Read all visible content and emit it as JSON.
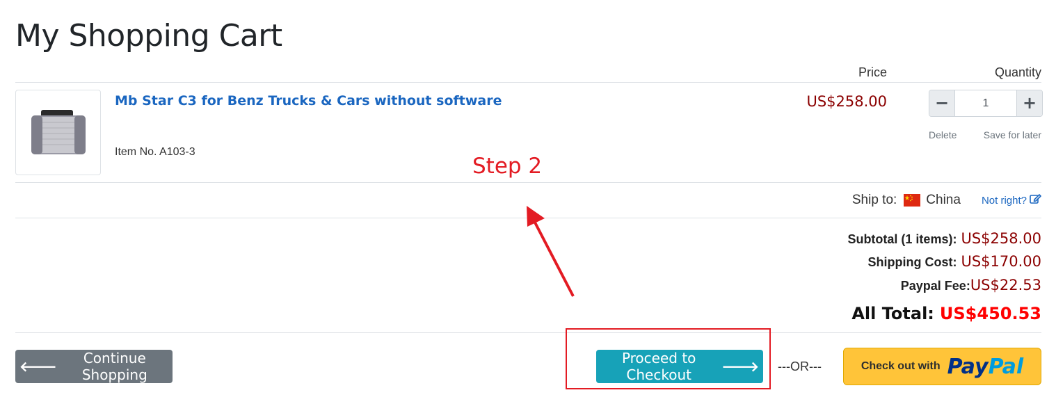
{
  "page": {
    "title": "My Shopping Cart"
  },
  "table_headers": {
    "price": "Price",
    "quantity": "Quantity"
  },
  "item": {
    "name": "Mb Star C3 for Benz Trucks & Cars without software",
    "item_no": "Item No. A103-3",
    "price": "US$258.00",
    "quantity": "1",
    "delete_label": "Delete",
    "save_label": "Save for later"
  },
  "annotation": {
    "step": "Step 2"
  },
  "shipping": {
    "label": "Ship to:",
    "country": "China",
    "not_right": "Not right?"
  },
  "summary": {
    "subtotal_label": "Subtotal (1 items):",
    "subtotal": "US$258.00",
    "shipping_label": "Shipping Cost:",
    "shipping": "US$170.00",
    "paypal_fee_label": "Paypal Fee:",
    "paypal_fee": "US$22.53",
    "total_label": "All Total:",
    "total": "US$450.53"
  },
  "actions": {
    "continue_label": "Continue Shopping",
    "checkout_label": "Proceed to Checkout",
    "or_label": "---OR---",
    "paypal_prefix": "Check out with",
    "paypal_pay": "Pay",
    "paypal_pal": "Pal"
  },
  "icons": {
    "back": "arrow-left-icon",
    "forward": "arrow-right-icon",
    "edit": "edit-icon",
    "minus": "minus-icon",
    "plus": "plus-icon",
    "flag": "china-flag-icon"
  },
  "colors": {
    "price": "#8b0000",
    "total": "#ff0000",
    "annotation": "#e31b23",
    "checkout": "#17a2b8",
    "continue": "#6c757d",
    "paypal": "#ffc439",
    "link": "#1a66c0"
  }
}
